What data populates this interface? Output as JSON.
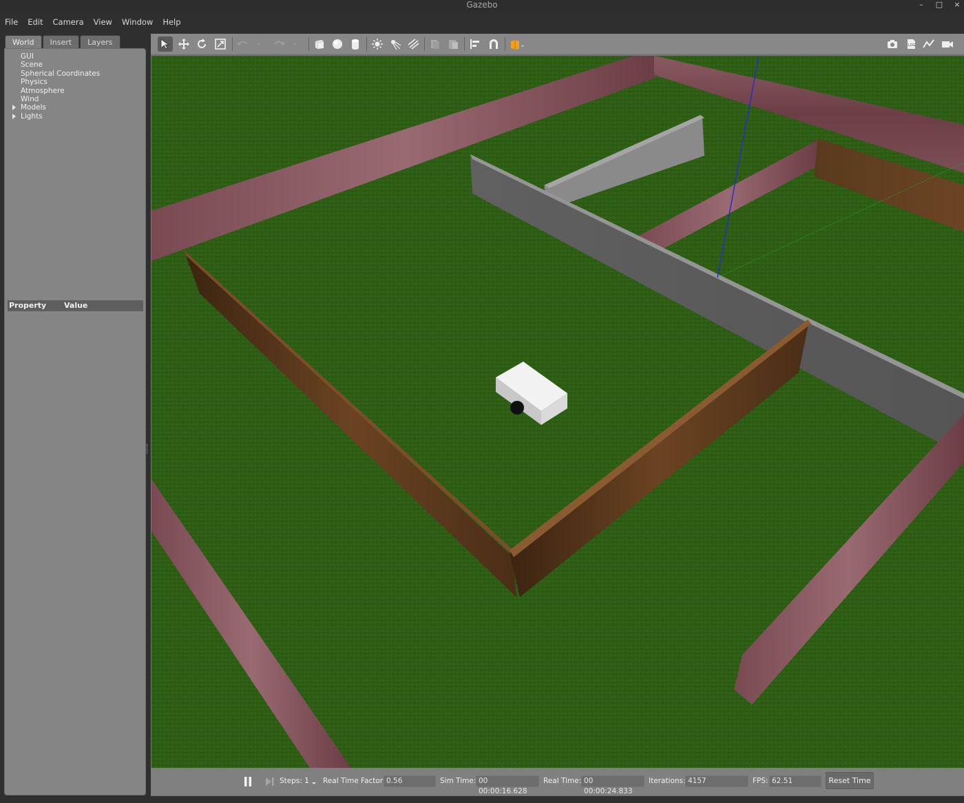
{
  "window": {
    "title": "Gazebo",
    "controls": [
      "–",
      "□",
      "×"
    ]
  },
  "menu": [
    "File",
    "Edit",
    "Camera",
    "View",
    "Window",
    "Help"
  ],
  "tabs": [
    "World",
    "Insert",
    "Layers"
  ],
  "tree": [
    "GUI",
    "Scene",
    "Spherical Coordinates",
    "Physics",
    "Atmosphere",
    "Wind",
    "Models",
    "Lights"
  ],
  "property_table": {
    "col1": "Property",
    "col2": "Value"
  },
  "toolbar": {
    "tools": [
      "select-mode",
      "translate-mode",
      "rotate-mode",
      "scale-mode",
      "undo",
      "redo",
      "box",
      "sphere",
      "cylinder",
      "point-light",
      "spot-light",
      "directional-light",
      "copy",
      "paste",
      "align",
      "snap",
      "change-view"
    ],
    "right_tools": [
      "screenshot",
      "log-data",
      "plot",
      "video-record"
    ]
  },
  "status": {
    "steps_label": "Steps:",
    "steps_value": "1",
    "rtf_label": "Real Time Factor:",
    "rtf_value": "0.56",
    "sim_time_label": "Sim Time:",
    "sim_time_value": "00 00:00:16.628",
    "real_time_label": "Real Time:",
    "real_time_value": "00 00:00:24.833",
    "iterations_label": "Iterations:",
    "iterations_value": "4157",
    "fps_label": "FPS:",
    "fps_value": "62.51",
    "reset_label": "Reset Time"
  },
  "colors": {
    "grass": "#2e5d16",
    "brick": "#7a4a4f",
    "wood": "#5c3a1f",
    "concrete": "#6a6a6a",
    "robot": "#dcdcdc",
    "axis_z": "#2b2bd0",
    "axis_y": "#2fa02f"
  }
}
